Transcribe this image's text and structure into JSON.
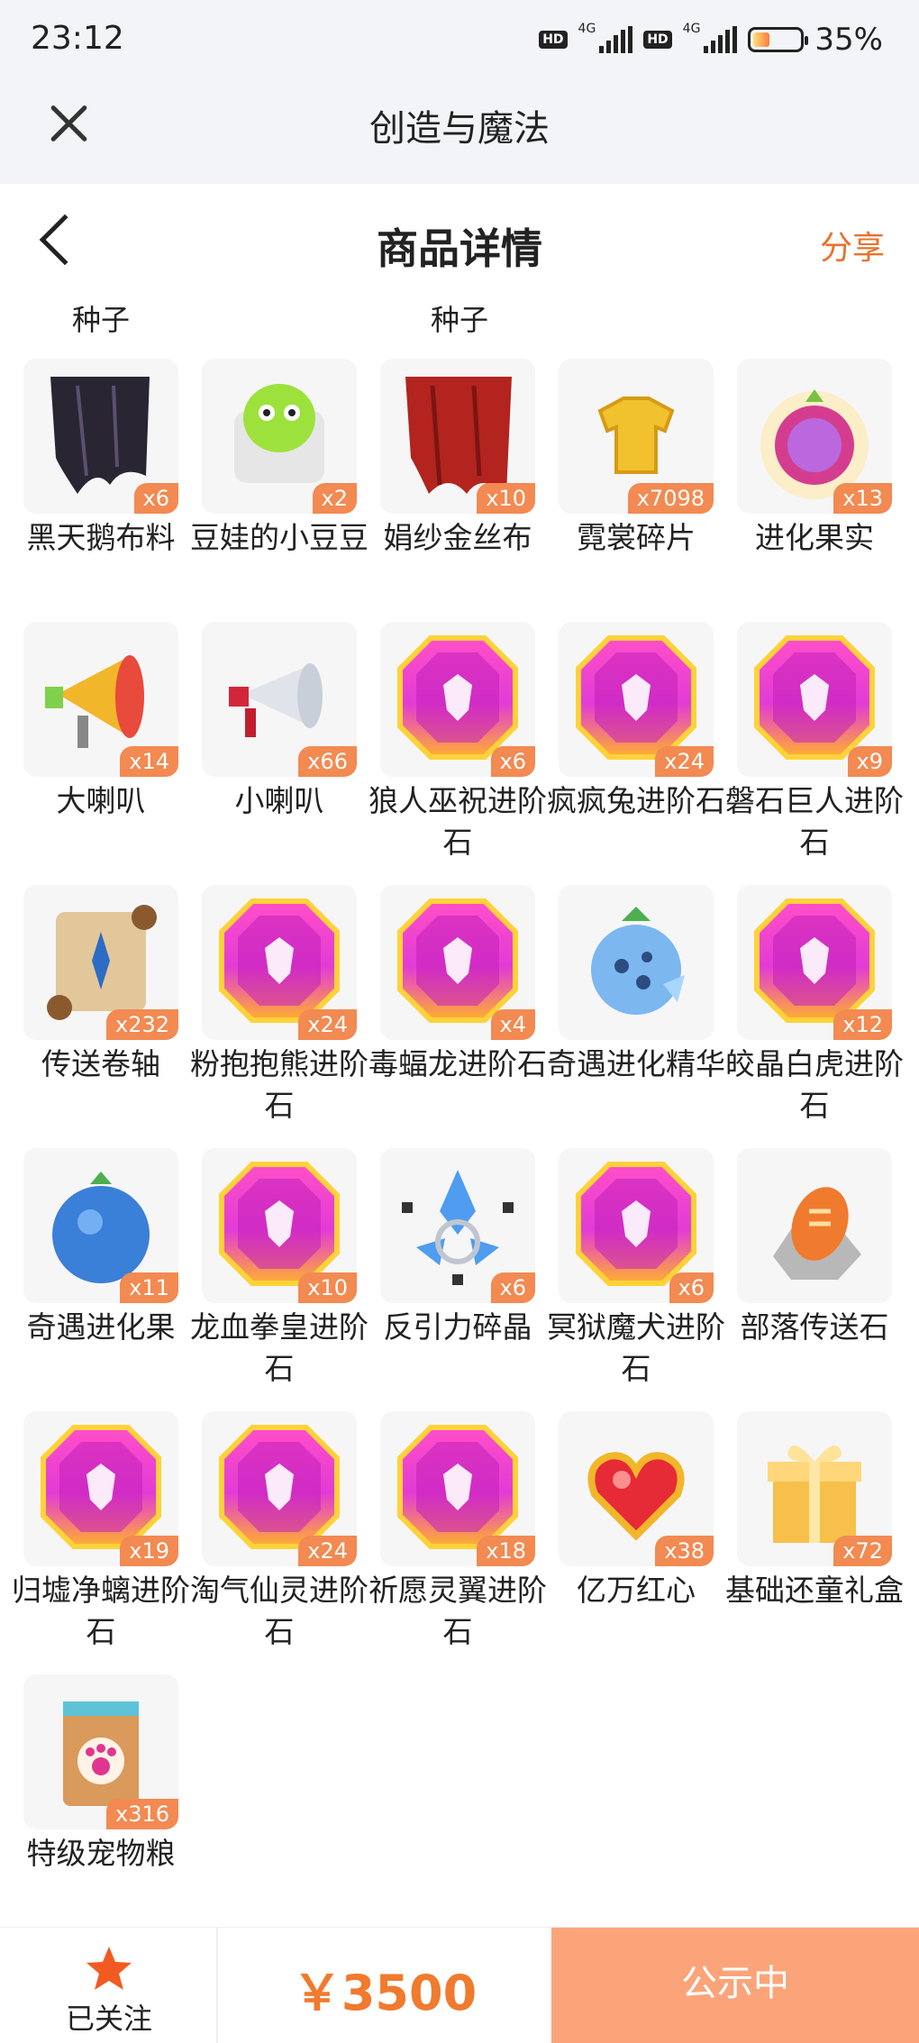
{
  "status_bar": {
    "time": "23:12",
    "battery": "35%",
    "network": "4G"
  },
  "app_bar": {
    "title": "创造与魔法"
  },
  "header": {
    "title": "商品详情",
    "share": "分享"
  },
  "seed_labels": [
    "种子",
    "种子"
  ],
  "items": [
    {
      "name": "黑天鹅布料",
      "count": "x6",
      "icon": "black-cloth-icon"
    },
    {
      "name": "豆娃的小豆豆",
      "count": "x2",
      "icon": "bean-doll-icon"
    },
    {
      "name": "娟纱金丝布",
      "count": "x10",
      "icon": "red-cloth-icon"
    },
    {
      "name": "霓裳碎片",
      "count": "x7098",
      "icon": "shirt-fragment-icon"
    },
    {
      "name": "进化果实",
      "count": "x13",
      "icon": "evolution-fruit-icon"
    },
    {
      "name": "大喇叭",
      "count": "x14",
      "icon": "big-megaphone-icon"
    },
    {
      "name": "小喇叭",
      "count": "x66",
      "icon": "small-megaphone-icon"
    },
    {
      "name": "狼人巫祝进阶石",
      "count": "x6",
      "icon": "gem-icon"
    },
    {
      "name": "疯疯兔进阶石",
      "count": "x24",
      "icon": "gem-icon"
    },
    {
      "name": "磐石巨人进阶石",
      "count": "x9",
      "icon": "gem-icon"
    },
    {
      "name": "传送卷轴",
      "count": "x232",
      "icon": "scroll-icon"
    },
    {
      "name": "粉抱抱熊进阶石",
      "count": "x24",
      "icon": "gem-icon"
    },
    {
      "name": "毒蝠龙进阶石",
      "count": "x4",
      "icon": "gem-icon"
    },
    {
      "name": "奇遇进化精华",
      "count": "",
      "icon": "evolution-essence-icon"
    },
    {
      "name": "皎晶白虎进阶石",
      "count": "x12",
      "icon": "gem-icon"
    },
    {
      "name": "奇遇进化果",
      "count": "x11",
      "icon": "blue-fruit-icon"
    },
    {
      "name": "龙血拳皇进阶石",
      "count": "x10",
      "icon": "gem-icon"
    },
    {
      "name": "反引力碎晶",
      "count": "x6",
      "icon": "crystal-shard-icon"
    },
    {
      "name": "冥狱魔犬进阶石",
      "count": "x6",
      "icon": "gem-icon"
    },
    {
      "name": "部落传送石",
      "count": "",
      "icon": "tribe-stone-icon"
    },
    {
      "name": "归墟净螭进阶石",
      "count": "x19",
      "icon": "gem-icon"
    },
    {
      "name": "淘气仙灵进阶石",
      "count": "x24",
      "icon": "gem-icon"
    },
    {
      "name": "祈愿灵翼进阶石",
      "count": "x18",
      "icon": "gem-icon"
    },
    {
      "name": "亿万红心",
      "count": "x38",
      "icon": "red-heart-icon"
    },
    {
      "name": "基础还童礼盒",
      "count": "x72",
      "icon": "gift-box-icon"
    },
    {
      "name": "特级宠物粮",
      "count": "x316",
      "icon": "pet-food-icon"
    }
  ],
  "bottom_bar": {
    "follow_label": "已关注",
    "price": "￥3500",
    "status_button": "公示中"
  },
  "colors": {
    "accent": "#f07a2e",
    "badge": "#f28a52",
    "status_button": "#fba47a"
  }
}
